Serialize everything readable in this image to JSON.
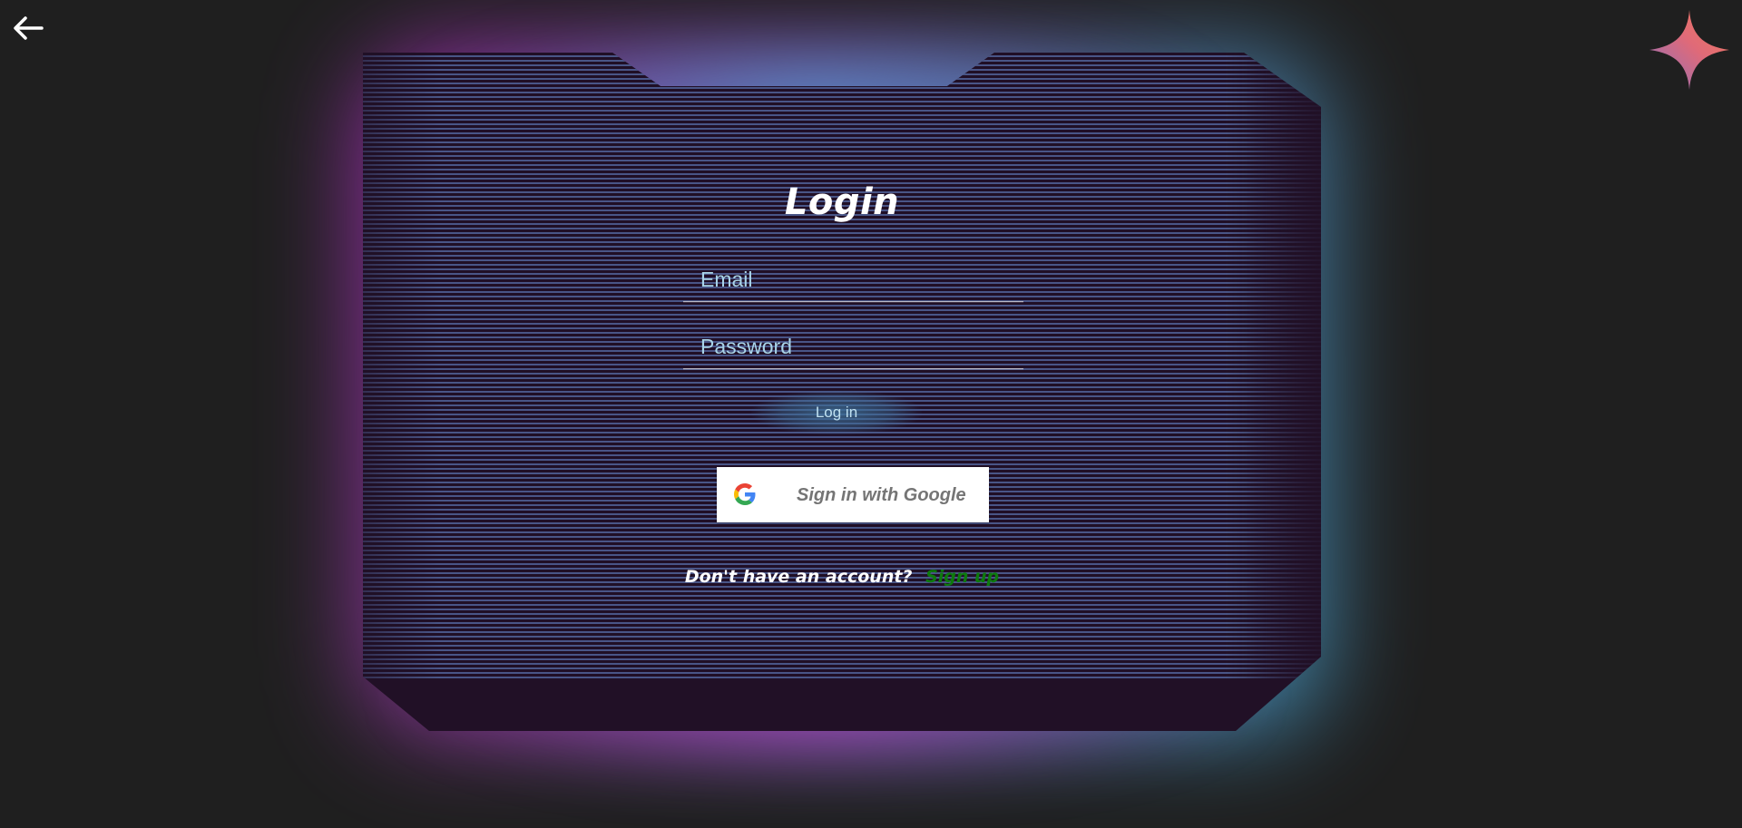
{
  "nav": {
    "back_icon": "arrow-left-icon",
    "corner_icon": "sparkle-icon"
  },
  "login": {
    "title": "Login",
    "email_placeholder": "Email",
    "password_placeholder": "Password",
    "submit_label": "Log in",
    "google_label": "Sign in with Google",
    "google_icon": "google-g-icon",
    "account_question": "Don't have an account?",
    "signup_label": "Sign up"
  },
  "colors": {
    "background": "#1f1f1f",
    "panel": "#211026",
    "glow_magenta": "#b42fc9",
    "glow_blue": "#4aa6d4",
    "input_text": "#a9d4e8",
    "signup_link": "#0d7a0d",
    "sparkle_start": "#8a6fc0",
    "sparkle_end": "#f06a5a"
  }
}
